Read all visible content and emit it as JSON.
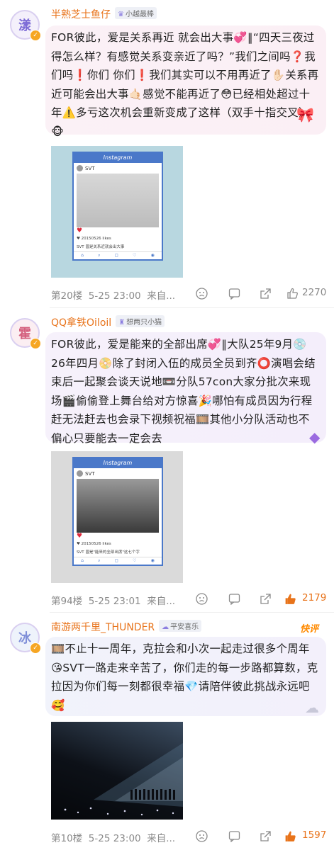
{
  "comments": [
    {
      "avatar_char": "漾",
      "username": "半熟芝士鱼仔",
      "badge": "小越最棒",
      "text": "FOR彼此，爱是关系再近 就会出大事💞‖“四天三夜过得怎么样？有感觉关系变亲近了吗？”我们之间吗❓我们吗❗你们 你们❗我们其实可以不用再近了✋🏻关系再近可能会出大事🤙🏻感觉不能再近了😳已经相处超过十年⚠️多亏这次机会重新变成了这样（双手十指交叉）🐵",
      "photo": {
        "header": "Instagram",
        "user": "SVT",
        "likes": "♥ 20150526 likes",
        "caption": "SVT 曾是关系近就会出大事"
      },
      "floor": "第20楼",
      "time": "5-25 23:00",
      "source": "来自...",
      "likes": "2270"
    },
    {
      "avatar_char": "霍",
      "username": "QQ拿铁Oiloil",
      "badge": "想两只小猫",
      "text": "FOR彼此，爱是能来的全部出席💞‖大队25年9月💿26年四月📀除了封闭入伍的成员全员到齐⭕演唱会结束后一起聚会谈天说地📼分队57con大家分批次来现场🎬偷偷登上舞台给对方惊喜🎉哪怕有成员因为行程赶无法赶去也会录下视频祝福🎞️其他小分队活动也不偏心只要能去一定会去",
      "photo": {
        "header": "Instagram",
        "user": "SVT",
        "likes": "♥ 20150526 likes",
        "caption": "SVT 曾是\"能来的全部出席\"这七个字"
      },
      "floor": "第94楼",
      "time": "5-25 23:01",
      "source": "来自...",
      "likes": "2179"
    },
    {
      "avatar_char": "冰",
      "username": "南游两千里_THUNDER",
      "badge": "平安喜乐",
      "corner_tag": "快评",
      "text": "🎞️不止十一周年，克拉会和小次一起走过很多个周年😘SVT一路走来辛苦了，你们走的每一步路都算数，克拉因为你们每一刻都很幸福💎请陪伴彼此挑战永远吧🥰",
      "floor": "第10楼",
      "time": "5-25 23:00",
      "source": "来自...",
      "likes": "1597"
    }
  ],
  "icons": [
    "sad-face-icon",
    "comment-icon",
    "share-icon",
    "thumbs-up-icon"
  ],
  "colors": {
    "username": "#e8731a",
    "meta": "#8a8a8a",
    "liked": "#e8731a",
    "bubble1": "#fbf1f6",
    "bubble2": "#f6f1fb"
  }
}
